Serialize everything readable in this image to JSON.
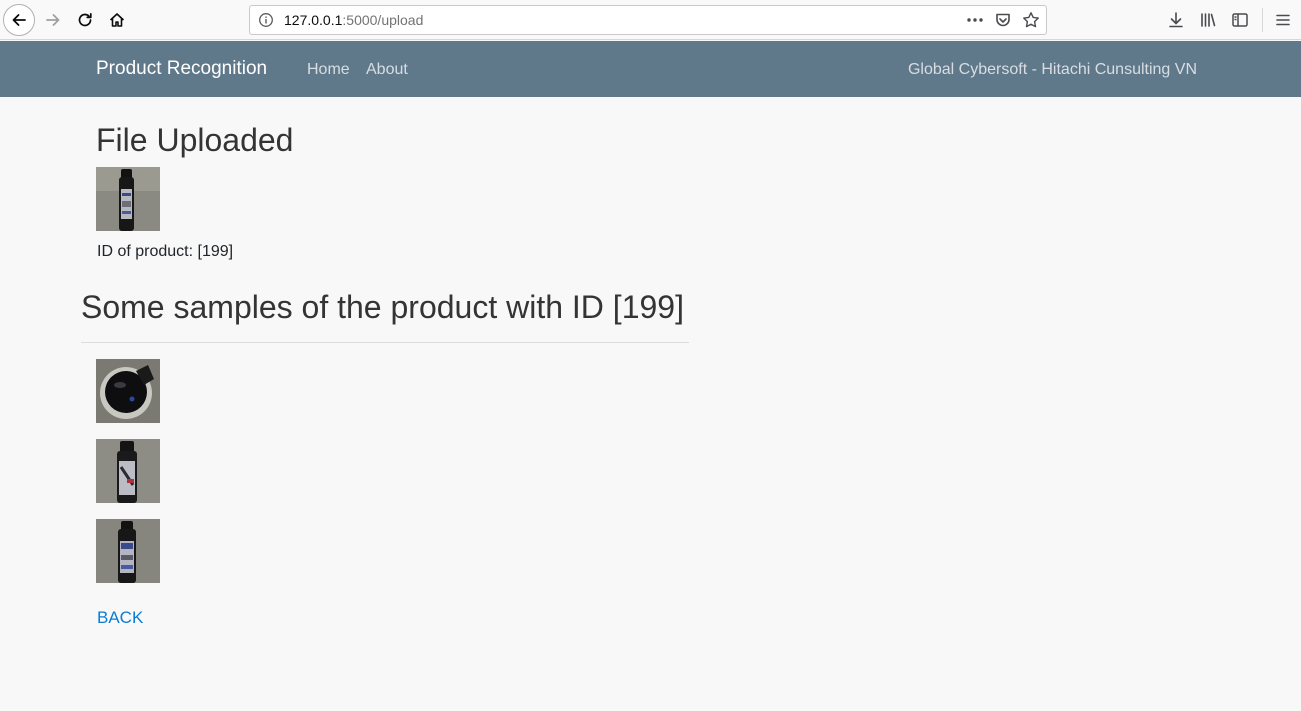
{
  "browser": {
    "url_host": "127.0.0.1",
    "url_path": ":5000/upload",
    "back_icon": "arrow-left-icon",
    "forward_icon": "arrow-right-icon",
    "reload_icon": "reload-icon",
    "home_icon": "home-icon"
  },
  "navbar": {
    "brand": "Product Recognition",
    "links": [
      "Home",
      "About"
    ],
    "right_text": "Global Cybersoft - Hitachi Cunsulting VN",
    "bg_color": "#5f788a"
  },
  "main": {
    "title": "File Uploaded",
    "id_line": "ID of product: [199]",
    "samples_heading": "Some samples of the product with ID [199]",
    "back_label": "BACK",
    "link_color": "#0a7cd4"
  }
}
